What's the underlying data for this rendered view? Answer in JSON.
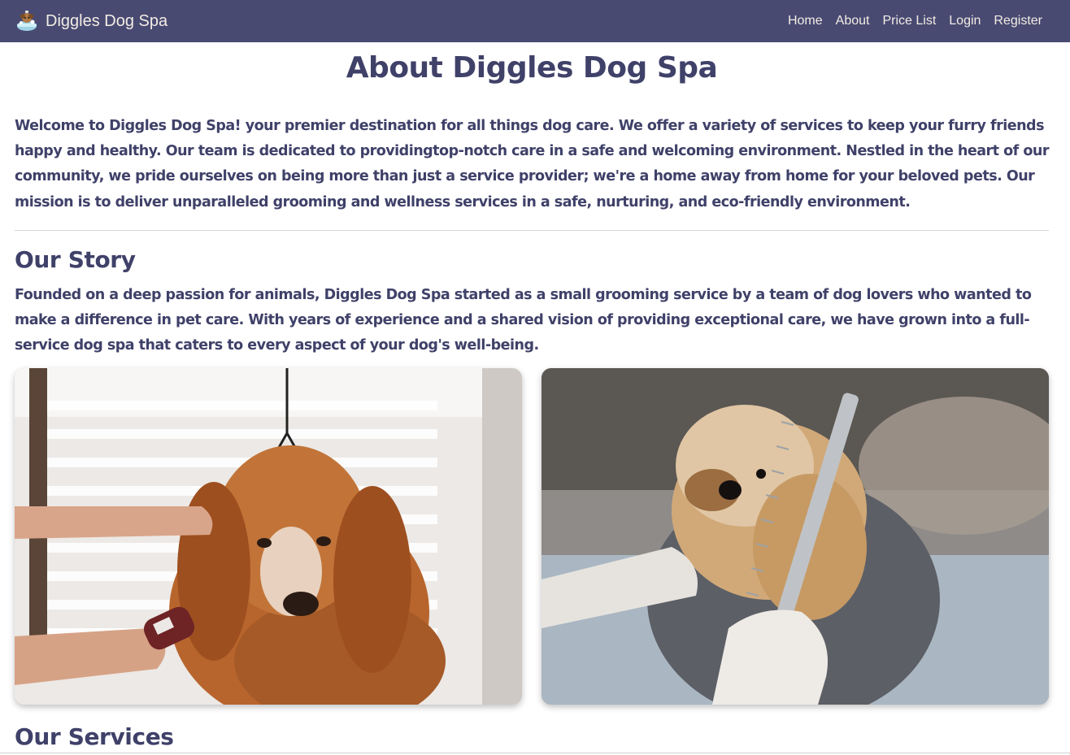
{
  "navbar": {
    "brand": "Diggles Dog Spa",
    "links": [
      "Home",
      "About",
      "Price List",
      "Login",
      "Register"
    ],
    "background": "#484a72",
    "text_color": "#f3ece4"
  },
  "page": {
    "title": "About Diggles Dog Spa",
    "intro": "Welcome to Diggles Dog Spa! your premier destination for all things dog care. We offer a variety of services to keep your furry friends happy and healthy. Our team is dedicated to providingtop-notch care in a safe and welcoming environment. Nestled in the heart of our community, we pride ourselves on being more than just a service provider; we're a home away from home for your beloved pets. Our mission is to deliver unparalleled grooming and wellness services in a safe, nurturing, and eco-friendly environment.",
    "story_heading": "Our Story",
    "story": "Founded on a deep passion for animals, Diggles Dog Spa started as a small grooming service by a team of dog lovers who wanted to make a difference in pet care. With years of experience and a shared vision of providing exceptional care, we have grown into a full-service dog spa that caters to every aspect of your dog's well-being.",
    "services_heading": "Our Services",
    "text_color": "#3f4169"
  },
  "gallery": {
    "images": [
      "dog-brushing-photo",
      "dog-combing-photo"
    ]
  }
}
